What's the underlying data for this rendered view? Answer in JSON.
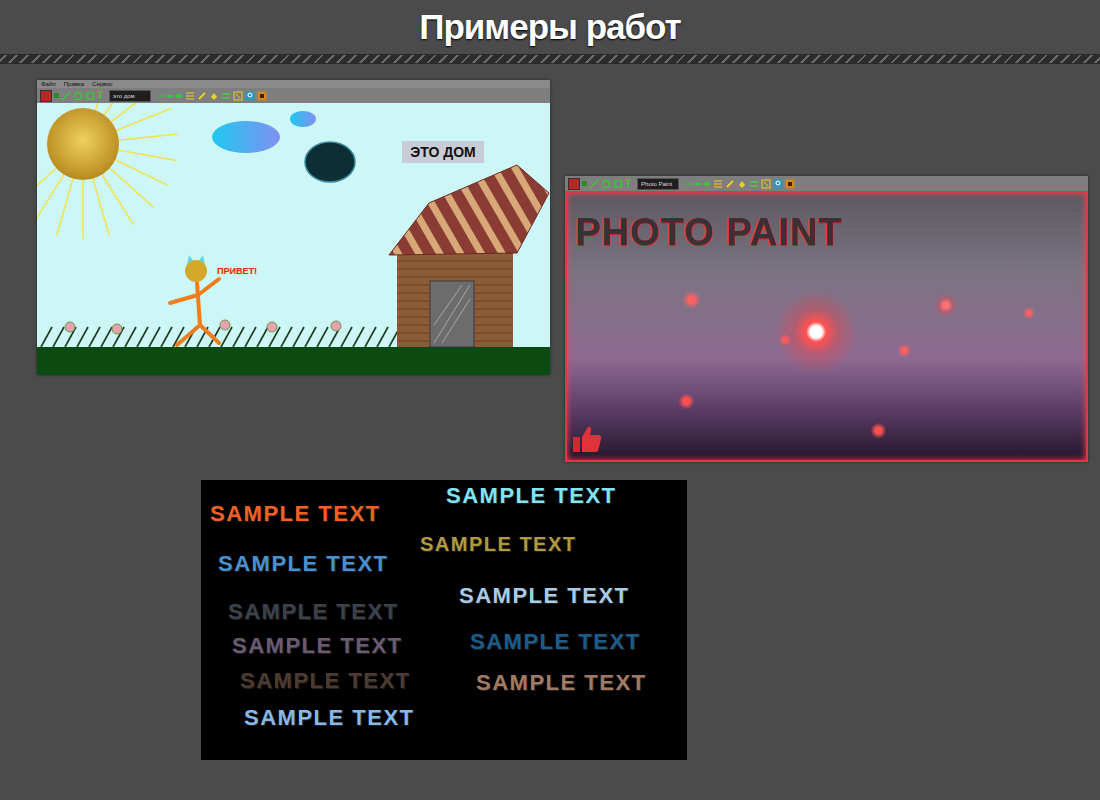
{
  "page": {
    "title": "Примеры работ"
  },
  "windows": [
    {
      "kind": "drawing",
      "menu": [
        "Файл",
        "Правка",
        "Сервис"
      ],
      "text_tool": "T",
      "field_value": "это дом",
      "canvas_texts": [
        {
          "kind": "sign",
          "text": "ЭТО ДОМ"
        },
        {
          "kind": "greeting",
          "text": "ПРИВЕТ!"
        }
      ]
    },
    {
      "kind": "photo",
      "menu": [],
      "text_tool": "T",
      "field_value": "Photo Paint",
      "canvas_texts": [
        {
          "kind": "headline",
          "text": "PHOTO PAINT"
        }
      ]
    }
  ],
  "sample_sheet": {
    "items": [
      {
        "text": "SAMPLE TEXT",
        "color": "#f06020"
      },
      {
        "text": "SAMPLE TEXT",
        "color": "#80e4f4"
      },
      {
        "text": "SAMPLE TEXT",
        "color": "#b09a40"
      },
      {
        "text": "SAMPLE TEXT",
        "color": "#4a90d0"
      },
      {
        "text": "SAMPLE TEXT",
        "color": "#3c424c"
      },
      {
        "text": "SAMPLE TEXT",
        "color": "#a8cce8"
      },
      {
        "text": "SAMPLE TEXT",
        "color": "#6a5a72"
      },
      {
        "text": "SAMPLE TEXT",
        "color": "#1c5c8c"
      },
      {
        "text": "SAMPLE TEXT",
        "color": "#4e3a30"
      },
      {
        "text": "SAMPLE TEXT",
        "color": "#a27a62"
      },
      {
        "text": "SAMPLE TEXT",
        "color": "#88b8e8"
      }
    ]
  }
}
